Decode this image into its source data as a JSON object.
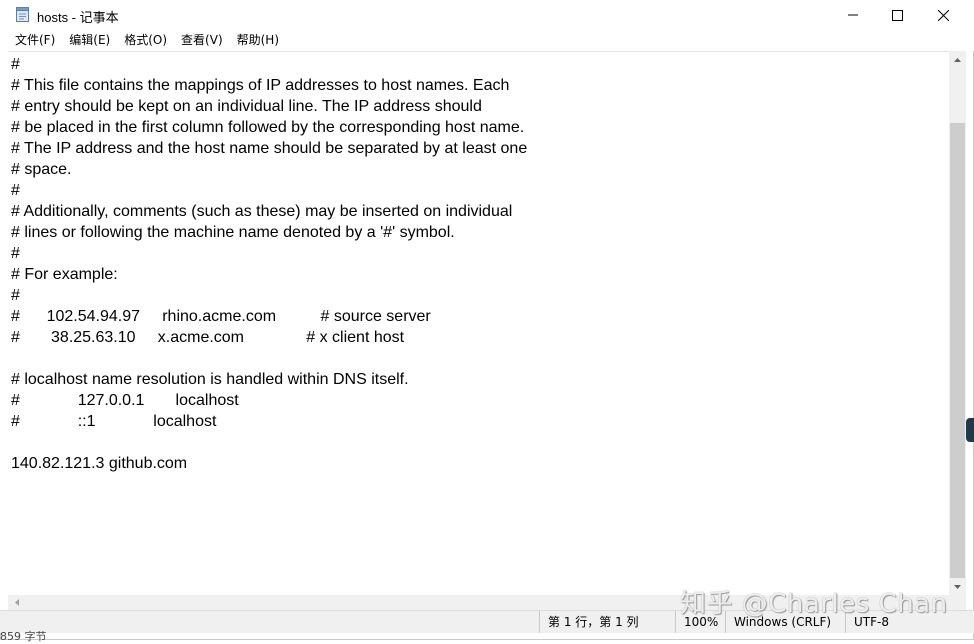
{
  "window": {
    "title": "hosts - 记事本"
  },
  "menu": {
    "items": [
      {
        "label": "文件(F)"
      },
      {
        "label": "编辑(E)"
      },
      {
        "label": "格式(O)"
      },
      {
        "label": "查看(V)"
      },
      {
        "label": "帮助(H)"
      }
    ]
  },
  "editor": {
    "lines": [
      "#",
      "# This file contains the mappings of IP addresses to host names. Each",
      "# entry should be kept on an individual line. The IP address should",
      "# be placed in the first column followed by the corresponding host name.",
      "# The IP address and the host name should be separated by at least one",
      "# space.",
      "#",
      "# Additionally, comments (such as these) may be inserted on individual",
      "# lines or following the machine name denoted by a '#' symbol.",
      "#",
      "# For example:",
      "#",
      "#      102.54.94.97     rhino.acme.com          # source server",
      "#       38.25.63.10     x.acme.com              # x client host",
      "",
      "# localhost name resolution is handled within DNS itself.",
      "#             127.0.0.1       localhost",
      "#             ::1             localhost",
      "",
      "140.82.121.3 github.com"
    ]
  },
  "status": {
    "position": "第 1 行，第 1 列",
    "zoom": "100%",
    "line_ending": "Windows (CRLF)",
    "encoding": "UTF-8"
  },
  "watermark": "知乎 @Charles Chan",
  "background": {
    "bottom_left_text": "859 字节"
  },
  "colors": {
    "scroll_track": "#f0f0f0",
    "scroll_thumb": "#cdcdcd",
    "status_bg": "#f0f0f0"
  }
}
